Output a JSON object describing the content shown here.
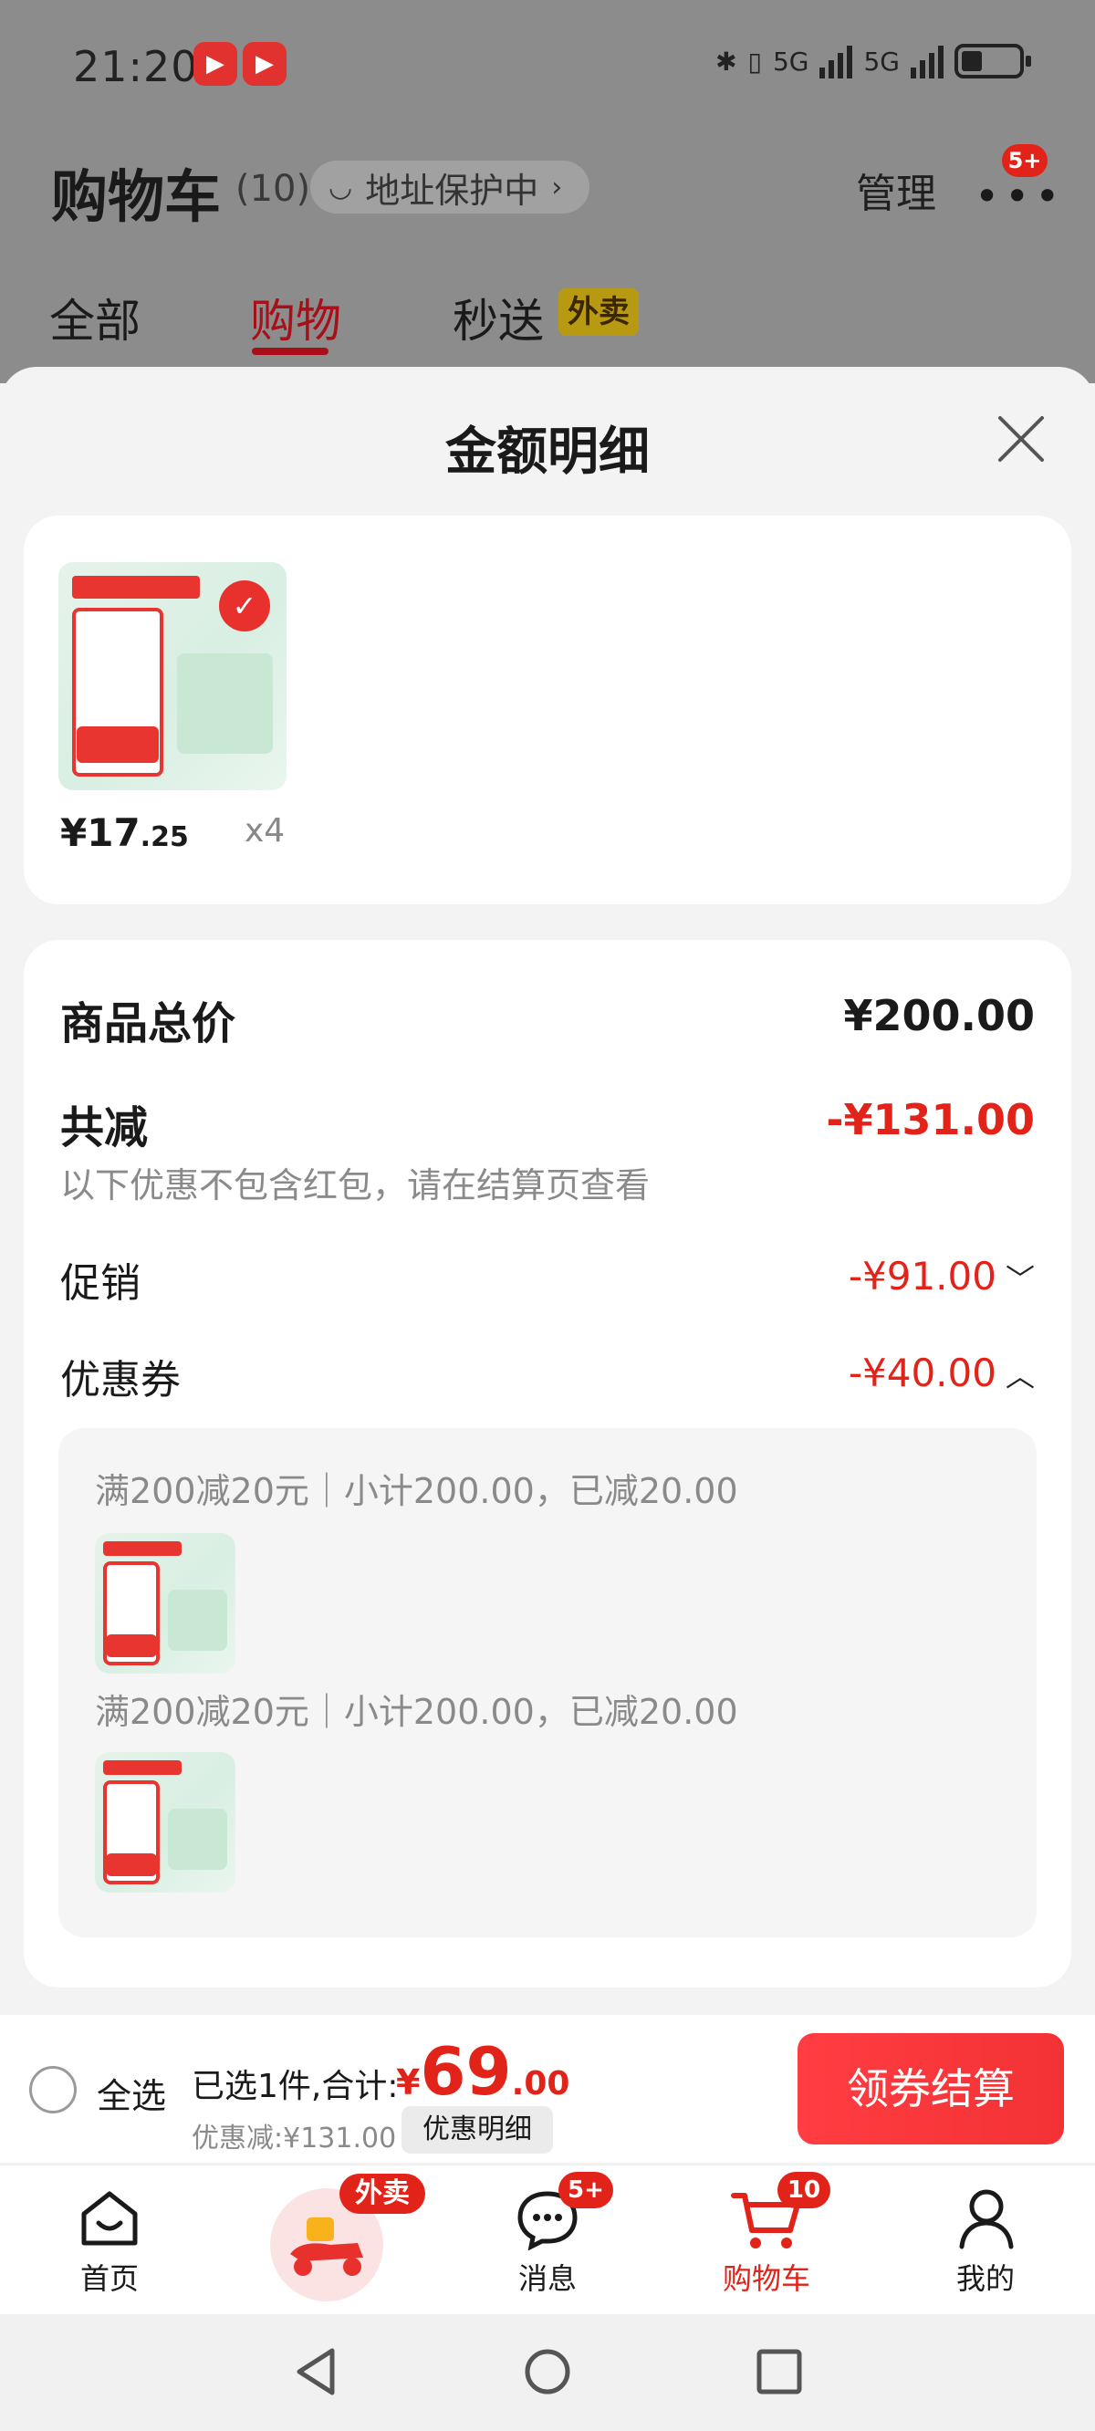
{
  "status": {
    "time": "21:20",
    "network1": "5G",
    "network2": "5G"
  },
  "header": {
    "title": "购物车",
    "count": "(10)",
    "address": "地址保护中",
    "manage": "管理",
    "more_badge": "5+"
  },
  "tabs": [
    {
      "label": "全部"
    },
    {
      "label": "购物"
    },
    {
      "label": "秒送"
    }
  ],
  "tab_tag": "外卖",
  "sheet": {
    "title": "金额明细",
    "product": {
      "price_int": "¥17",
      "price_dec": ".25",
      "qty": "x4"
    },
    "total_label": "商品总价",
    "total_value": "¥200.00",
    "discount_label": "共减",
    "discount_value": "-¥131.00",
    "discount_note": "以下优惠不包含红包，请在结算页查看",
    "promo_label": "促销",
    "promo_value": "-¥91.00",
    "coupon_label": "优惠券",
    "coupon_value": "-¥40.00",
    "coupon_lines": [
      "满200减20元｜小计200.00，已减20.00",
      "满200减20元｜小计200.00，已减20.00"
    ]
  },
  "checkout": {
    "select_all": "全选",
    "selected": "已选1件,合计:",
    "currency": "¥",
    "amount_int": "69",
    "amount_dec": ".00",
    "discount": "优惠减:¥131.00",
    "detail_button": "优惠明细",
    "checkout_button": "领券结算"
  },
  "tabbar": [
    {
      "label": "首页"
    },
    {
      "label": ""
    },
    {
      "label": "消息"
    },
    {
      "label": "购物车"
    },
    {
      "label": "我的"
    }
  ],
  "tabbar_badges": {
    "waimai": "外卖",
    "messages": "5+",
    "cart": "10"
  },
  "colors": {
    "accent": "#e2231a",
    "tab_active": "#a80f18"
  }
}
